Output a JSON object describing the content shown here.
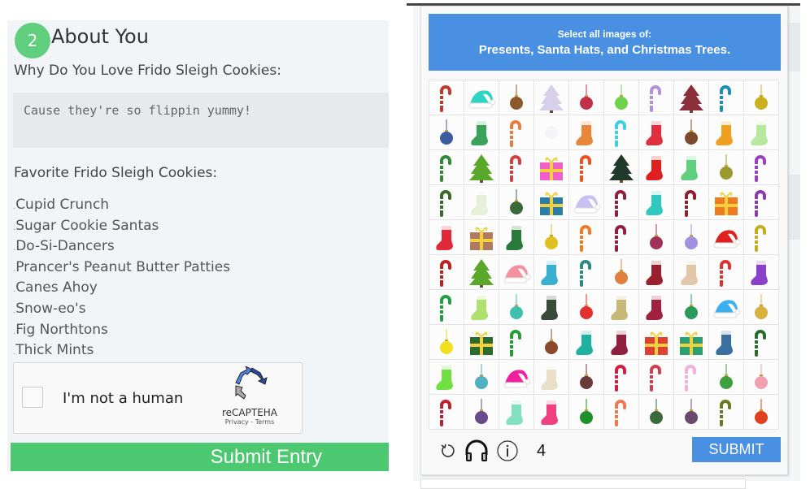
{
  "about": {
    "step": "2",
    "title": "About You",
    "why_label": "Why Do You Love Frido Sleigh Cookies:",
    "why_value": "Cause they're so flippin yummy!",
    "fav_label": "Favorite Frido Sleigh Cookies:",
    "cookies": [
      "Cupid Crunch",
      "Sugar Cookie Santas",
      "Do-Si-Dancers",
      "Prancer's Peanut Butter Patties",
      "Canes Ahoy",
      "Snow-eo's",
      "Fig Northtons",
      "Thick Mints"
    ],
    "recaptcha": {
      "checkbox_label": "I'm not a human",
      "brand": "reCAPTEHA",
      "links": "Privacy - Terms"
    },
    "submit_label": "Submit Entry"
  },
  "captcha": {
    "prompt": "Select all images of:",
    "targets": "Presents, Santa Hats, and Christmas Trees.",
    "count": "4",
    "submit_label": "SUBMIT",
    "icons": [
      "refresh-icon",
      "headphones-icon",
      "info-icon"
    ],
    "colors": {
      "banner": "#4a90e2",
      "submit": "#4a90e2",
      "submit_entry": "#4cc970"
    },
    "grid": [
      [
        [
          "candy-cane",
          "#c0392b"
        ],
        [
          "santa-hat",
          "#2ed3c2"
        ],
        [
          "ornament",
          "#8b5a2b"
        ],
        [
          "tree",
          "#d8d0ea"
        ],
        [
          "ornament",
          "#c0304a"
        ],
        [
          "ornament",
          "#6fd24a"
        ],
        [
          "candy-cane",
          "#b58ee0"
        ],
        [
          "tree",
          "#8b2f3a"
        ],
        [
          "candy-cane",
          "#1a8fb5"
        ],
        [
          "ornament",
          "#c8b020"
        ]
      ],
      [
        [
          "ornament",
          "#3a5ba0"
        ],
        [
          "stocking",
          "#3aa35a"
        ],
        [
          "candy-cane",
          "#e87d3e"
        ],
        [
          "blank",
          "#f4f4f8"
        ],
        [
          "stocking",
          "#e8863a"
        ],
        [
          "candy-cane",
          "#3fd0e0"
        ],
        [
          "stocking",
          "#e03040"
        ],
        [
          "ornament",
          "#7a4a2a"
        ],
        [
          "stocking",
          "#f0a020"
        ],
        [
          "stocking",
          "#b8e8a0"
        ]
      ],
      [
        [
          "candy-cane",
          "#2e8b3a"
        ],
        [
          "tree",
          "#5aa82a"
        ],
        [
          "candy-cane",
          "#d04040"
        ],
        [
          "present",
          "#f060c8"
        ],
        [
          "candy-cane",
          "#f05020"
        ],
        [
          "tree",
          "#1f3a2a"
        ],
        [
          "stocking",
          "#e02020"
        ],
        [
          "stocking",
          "#60d080"
        ],
        [
          "ornament",
          "#9a9a30"
        ],
        [
          "candy-cane",
          "#9a40c0"
        ]
      ],
      [
        [
          "candy-cane",
          "#3a6a2a"
        ],
        [
          "stocking",
          "#e6f0d8"
        ],
        [
          "ornament",
          "#3a6a3a"
        ],
        [
          "present",
          "#2a7fa8"
        ],
        [
          "santa-hat",
          "#c8c0f0"
        ],
        [
          "candy-cane",
          "#902040"
        ],
        [
          "stocking",
          "#30c8c0"
        ],
        [
          "candy-cane",
          "#902030"
        ],
        [
          "present",
          "#f07a20"
        ],
        [
          "candy-cane",
          "#8a3ab0"
        ]
      ],
      [
        [
          "stocking",
          "#e02838"
        ],
        [
          "present",
          "#b07a60"
        ],
        [
          "stocking",
          "#2a7a3a"
        ],
        [
          "ornament",
          "#e0c020"
        ],
        [
          "candy-cane",
          "#f07a20"
        ],
        [
          "candy-cane",
          "#902040"
        ],
        [
          "ornament",
          "#a0305a"
        ],
        [
          "ornament",
          "#a090e0"
        ],
        [
          "santa-hat",
          "#e02020"
        ],
        [
          "candy-cane",
          "#c0b020"
        ]
      ],
      [
        [
          "candy-cane",
          "#c02020"
        ],
        [
          "tree",
          "#5aa82a"
        ],
        [
          "santa-hat",
          "#f590a0"
        ],
        [
          "stocking",
          "#3ab0d0"
        ],
        [
          "candy-cane",
          "#2a8a8a"
        ],
        [
          "ornament",
          "#e08040"
        ],
        [
          "stocking",
          "#9a2030"
        ],
        [
          "stocking",
          "#e0c8a8"
        ],
        [
          "candy-cane",
          "#e03030"
        ],
        [
          "stocking",
          "#8a40c8"
        ]
      ],
      [
        [
          "candy-cane",
          "#20a040"
        ],
        [
          "stocking",
          "#b0e070"
        ],
        [
          "ornament",
          "#40c0b0"
        ],
        [
          "stocking",
          "#3a4a3a"
        ],
        [
          "ornament",
          "#e03030"
        ],
        [
          "stocking",
          "#c8b878"
        ],
        [
          "stocking",
          "#a02040"
        ],
        [
          "ornament",
          "#2a9a5a"
        ],
        [
          "santa-hat",
          "#3ab0f0"
        ],
        [
          "ornament",
          "#d8b040"
        ]
      ],
      [
        [
          "ornament",
          "#f0e020"
        ],
        [
          "present",
          "#2a6a2a"
        ],
        [
          "candy-cane",
          "#20a030"
        ],
        [
          "ornament",
          "#8a4a2a"
        ],
        [
          "stocking",
          "#20b0a0"
        ],
        [
          "stocking",
          "#902040"
        ],
        [
          "present",
          "#e04030"
        ],
        [
          "present",
          "#2aa070"
        ],
        [
          "stocking",
          "#3a70a0"
        ],
        [
          "candy-cane",
          "#2a6a2a"
        ]
      ],
      [
        [
          "stocking",
          "#70e040"
        ],
        [
          "ornament",
          "#50b0c0"
        ],
        [
          "santa-hat",
          "#f020a0"
        ],
        [
          "stocking",
          "#e8e0c8"
        ],
        [
          "ornament",
          "#6a3a3a"
        ],
        [
          "candy-cane",
          "#d02040"
        ],
        [
          "candy-cane",
          "#d04050"
        ],
        [
          "candy-cane",
          "#f0b0e0"
        ],
        [
          "ornament",
          "#40a040"
        ],
        [
          "ornament",
          "#f0a0b0"
        ]
      ],
      [
        [
          "candy-cane",
          "#c02030"
        ],
        [
          "ornament",
          "#6a4a8a"
        ],
        [
          "stocking",
          "#80e0c0"
        ],
        [
          "stocking",
          "#f04080"
        ],
        [
          "ornament",
          "#20902a"
        ],
        [
          "candy-cane",
          "#f07a50"
        ],
        [
          "ornament",
          "#3a6a3a"
        ],
        [
          "ornament",
          "#6a4a6a"
        ],
        [
          "candy-cane",
          "#6a7a20"
        ],
        [
          "ornament",
          "#e04020"
        ]
      ]
    ]
  }
}
